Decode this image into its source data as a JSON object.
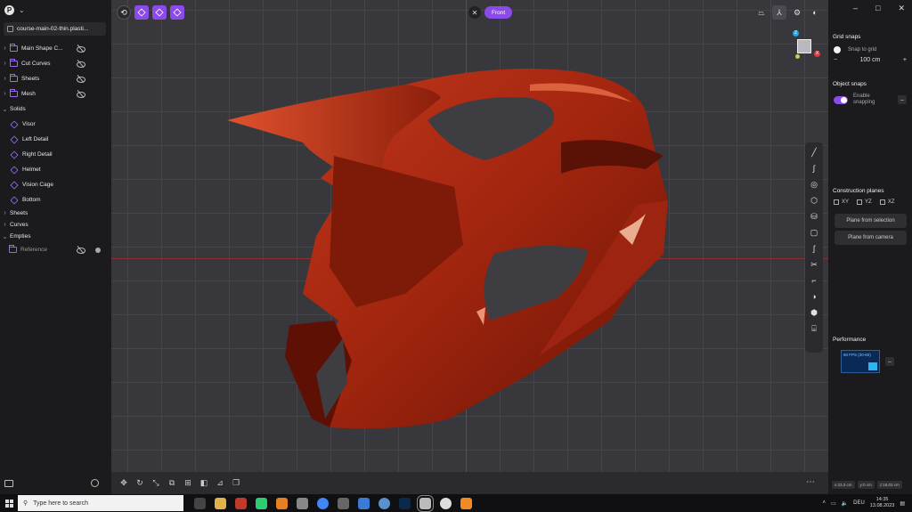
{
  "sidebar": {
    "file_tab": "course-main-02-thin.plasti...",
    "groups": [
      {
        "label": "Main Shape C..."
      },
      {
        "label": "Cut Curves"
      },
      {
        "label": "Sheets"
      },
      {
        "label": "Mesh"
      }
    ],
    "solids_header": "Solids",
    "solids": [
      {
        "label": "Visor"
      },
      {
        "label": "Left Detail"
      },
      {
        "label": "Right Detail"
      },
      {
        "label": "Helmet"
      },
      {
        "label": "Vision Cage"
      },
      {
        "label": "Bottom"
      }
    ],
    "sections": [
      {
        "label": "Sheets"
      },
      {
        "label": "Curves"
      },
      {
        "label": "Empties"
      }
    ],
    "empties_item": "Reference"
  },
  "viewport": {
    "view_label": "Front",
    "accent": "#8b4bea",
    "gizmo": {
      "z": "Z",
      "x": "X"
    }
  },
  "panel": {
    "grid_snaps_title": "Grid snaps",
    "snap_to_grid": "Snap to grid",
    "grid_size": "100 cm",
    "object_snaps_title": "Object snaps",
    "enable_snapping": "Enable snapping",
    "construction_planes_title": "Construction planes",
    "planes": [
      "XY",
      "YZ",
      "XZ"
    ],
    "plane_from_selection": "Plane from selection",
    "plane_from_camera": "Plane from camera",
    "performance_title": "Performance",
    "fps_label": "60 FPS (20-60)",
    "coords": [
      "x:23,3 cm",
      "y:0 cm",
      "z:18,03 cm"
    ]
  },
  "taskbar": {
    "search_placeholder": "Type here to search",
    "lang": "DEU",
    "time": "14:35",
    "date": "13.08.2023"
  }
}
